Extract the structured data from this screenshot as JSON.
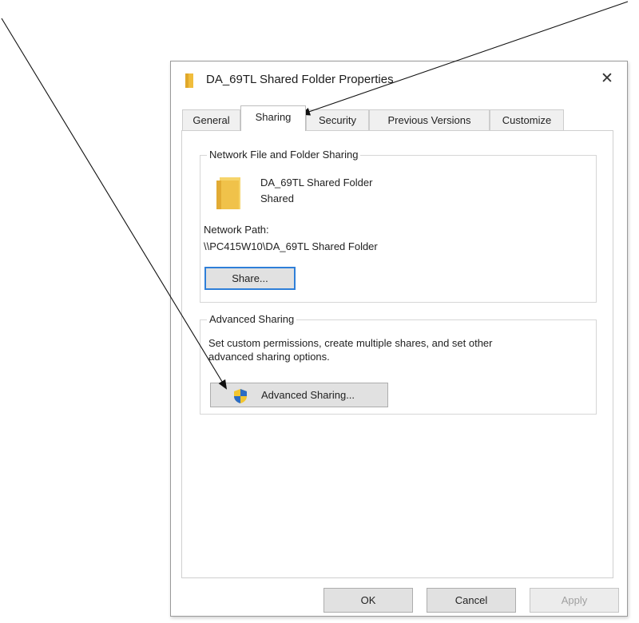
{
  "window": {
    "title": "DA_69TL Shared Folder Properties",
    "close_symbol": "✕"
  },
  "tabs": [
    {
      "label": "General",
      "active": false
    },
    {
      "label": "Sharing",
      "active": true
    },
    {
      "label": "Security",
      "active": false
    },
    {
      "label": "Previous Versions",
      "active": false
    },
    {
      "label": "Customize",
      "active": false
    }
  ],
  "network_sharing": {
    "legend": "Network File and Folder Sharing",
    "folder_name": "DA_69TL Shared Folder",
    "status": "Shared",
    "path_label": "Network Path:",
    "path_value": "\\\\PC415W10\\DA_69TL Shared Folder",
    "share_button": "Share..."
  },
  "advanced_sharing": {
    "legend": "Advanced Sharing",
    "description_line1": "Set custom permissions, create multiple shares, and set other",
    "description_line2": "advanced sharing options.",
    "button": "Advanced Sharing..."
  },
  "footer": {
    "ok": "OK",
    "cancel": "Cancel",
    "apply": "Apply"
  },
  "icons": {
    "title": "folder-icon",
    "folder": "folder-icon",
    "shield": "uac-shield-icon"
  },
  "colors": {
    "folder": "#f4c84a",
    "focus_border": "#2f7fd8",
    "button_face": "#e1e1e1"
  }
}
